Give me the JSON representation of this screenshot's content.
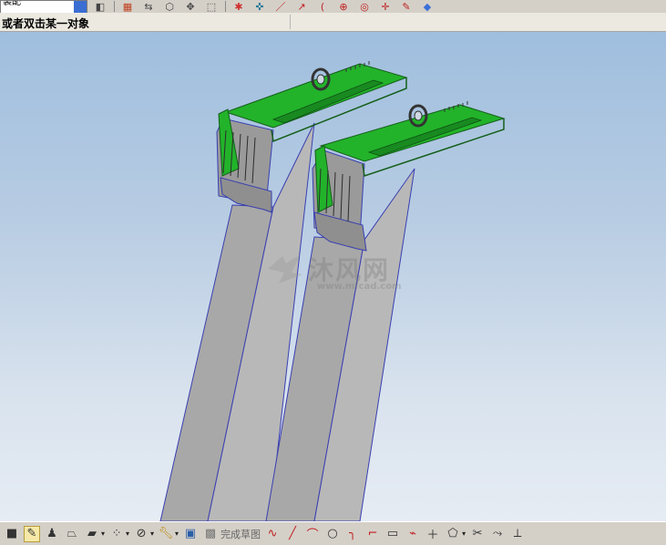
{
  "toolbar": {
    "selection_filter_value": "装配",
    "icons": [
      "view-icon",
      "layer-icon",
      "fit-icon",
      "rotate-icon",
      "pan-icon",
      "select-box-icon",
      "snap-icon",
      "point-icon",
      "line-icon",
      "arc-icon",
      "center-icon",
      "circle-icon",
      "target-icon",
      "cross-icon",
      "edit-icon",
      "cube-icon"
    ]
  },
  "status": {
    "prompt": "或者双击某一对象"
  },
  "viewport": {
    "background_top": "#9fbede",
    "background_bottom": "#e6ecf3",
    "part_color": "#a9a9a9",
    "face_highlight_color": "#22b32a",
    "edge_color": "#3a3fb0"
  },
  "watermark": {
    "text": "沐风网",
    "url": "www.mfcad.com"
  },
  "bottom_toolbar": {
    "finish_sketch_label": "完成草图",
    "icons": [
      "square-icon",
      "pencil-icon",
      "person-icon",
      "trapezoid-icon",
      "box-icon",
      "pattern-icon",
      "no-entry-icon",
      "wrench-icon",
      "sketch-icon",
      "sketch-grid-icon",
      "profile-icon",
      "line-icon",
      "arc-icon",
      "circle-icon",
      "fillet-icon",
      "chamfer-icon",
      "rectangle-icon",
      "polyline-icon",
      "point-icon",
      "shape-icon",
      "trim-icon",
      "extend-icon",
      "split-icon",
      "offset-icon",
      "angle-icon"
    ]
  }
}
